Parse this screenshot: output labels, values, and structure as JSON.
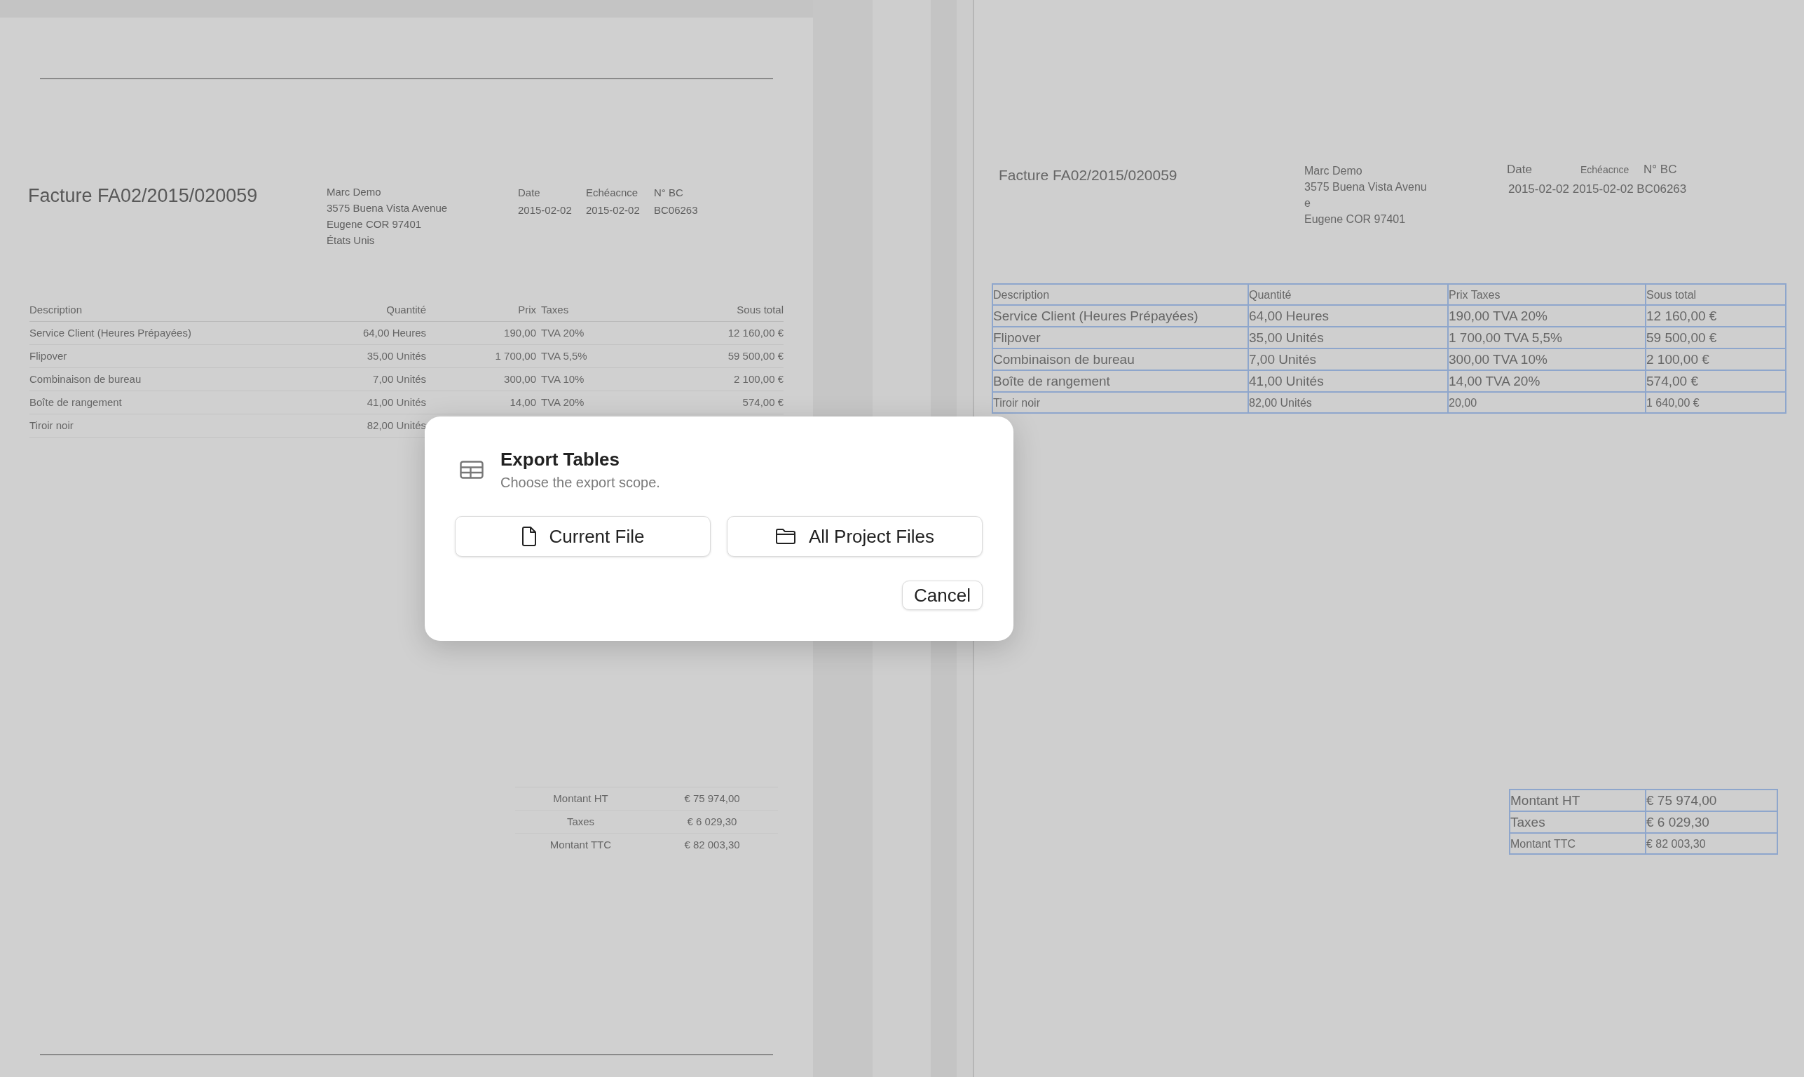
{
  "left_document": {
    "title": "Facture FA02/2015/020059",
    "address": [
      "Marc Demo",
      "3575 Buena Vista Avenue",
      "Eugene COR 97401",
      "États Unis"
    ],
    "info_headers": [
      "Date",
      "Echéacnce",
      "N° BC"
    ],
    "info_values": [
      "2015-02-02",
      "2015-02-02",
      "BC06263"
    ],
    "table": {
      "columns": [
        "Description",
        "Quantité",
        "Prix",
        "Taxes",
        "Sous total"
      ],
      "rows": [
        [
          "Service Client (Heures Prépayées)",
          "64,00 Heures",
          "190,00",
          "TVA 20%",
          "12 160,00 €"
        ],
        [
          "Flipover",
          "35,00 Unités",
          "1 700,00",
          "TVA 5,5%",
          "59 500,00 €"
        ],
        [
          "Combinaison de bureau",
          "7,00 Unités",
          "300,00",
          "TVA 10%",
          "2 100,00 €"
        ],
        [
          "Boîte de rangement",
          "41,00 Unités",
          "14,00",
          "TVA 20%",
          "574,00 €"
        ],
        [
          "Tiroir noir",
          "82,00 Unités"
        ]
      ]
    },
    "totals": [
      [
        "Montant HT",
        "€ 75 974,00"
      ],
      [
        "Taxes",
        "€ 6 029,30"
      ],
      [
        "Montant TTC",
        "€ 82 003,30"
      ]
    ]
  },
  "right_document": {
    "title": "Facture FA02/2015/020059",
    "address": [
      "Marc Demo",
      "3575 Buena Vista Avenu",
      "e",
      "Eugene COR 97401"
    ],
    "info_headers": [
      "Date",
      "Echéacnce",
      "N° BC"
    ],
    "info_values": "2015-02-02 2015-02-02 BC06263",
    "table": {
      "columns": [
        "Description",
        "Quantité",
        "Prix Taxes",
        "Sous total"
      ],
      "rows": [
        [
          "Service Client (Heures Prépayées)",
          "64,00 Heures",
          "190,00 TVA 20%",
          "12 160,00 €"
        ],
        [
          "Flipover",
          "35,00 Unités",
          "1 700,00 TVA 5,5%",
          "59 500,00 €"
        ],
        [
          "Combinaison de bureau",
          "7,00 Unités",
          "300,00 TVA 10%",
          "2 100,00 €"
        ],
        [
          "Boîte de rangement",
          "41,00 Unités",
          "14,00 TVA 20%",
          "574,00 €"
        ],
        [
          "Tiroir noir",
          "82,00 Unités",
          "20,00",
          "1 640,00 €"
        ]
      ]
    },
    "totals": [
      [
        "Montant HT",
        "€ 75 974,00"
      ],
      [
        "Taxes",
        "€ 6 029,30"
      ],
      [
        "Montant TTC",
        "€ 82 003,30"
      ]
    ]
  },
  "dialog": {
    "title": "Export Tables",
    "subtitle": "Choose the export scope.",
    "options": [
      {
        "label": "Current File",
        "kind": "file"
      },
      {
        "label": "All Project Files",
        "kind": "folder"
      }
    ],
    "cancel": "Cancel"
  }
}
